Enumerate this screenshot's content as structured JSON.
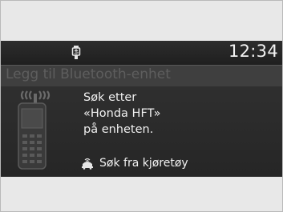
{
  "status": {
    "time": "12:34",
    "usb_icon": "usb-icon"
  },
  "title": "Legg til Bluetooth-enhet",
  "instructions": {
    "line1": "Søk etter",
    "line2": "«Honda HFT»",
    "line3": "på enheten."
  },
  "search_from_vehicle": {
    "label": "Søk fra kjøretøy",
    "icon": "vehicle-search-icon"
  },
  "phone_icon": "bluetooth-phone-icon",
  "colors": {
    "screen_bg": "#2a2a2a",
    "title_bg": "#3f3f3f",
    "title_text": "#5e5e5e",
    "text": "#f0f0f0",
    "outer_bg": "#e8e8e8"
  }
}
